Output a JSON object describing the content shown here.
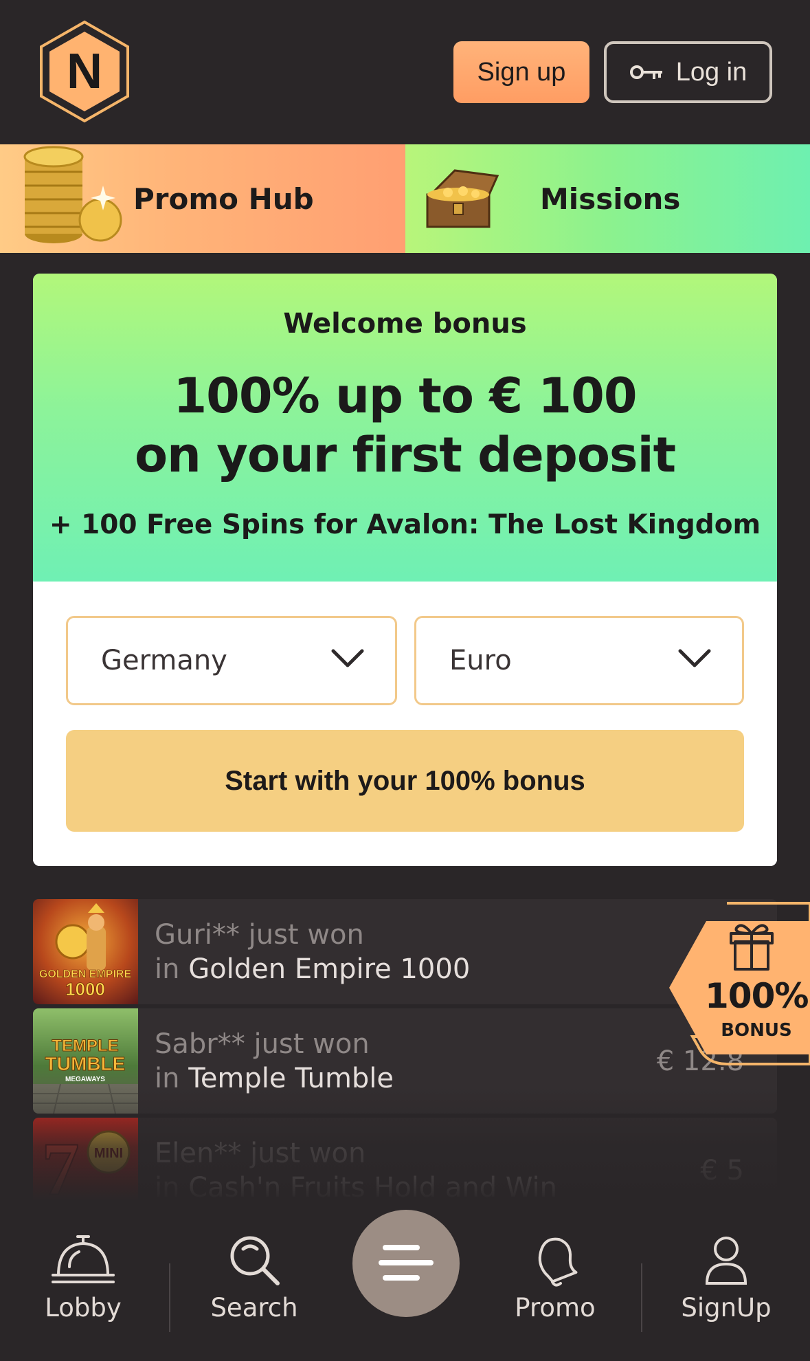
{
  "header": {
    "logo_letter": "N",
    "signup_label": "Sign up",
    "login_label": "Log in"
  },
  "promo_bar": {
    "promo_hub_label": "Promo Hub",
    "missions_label": "Missions"
  },
  "bonus": {
    "eyebrow": "Welcome bonus",
    "headline_line1": "100% up to € 100",
    "headline_line2": "on your first deposit",
    "subline": "+ 100 Free Spins for Avalon: The Lost Kingdom",
    "country_value": "Germany",
    "currency_value": "Euro",
    "cta_label": "Start with your 100% bonus"
  },
  "feed": {
    "rows": [
      {
        "player": "Guri** just won",
        "prefix": "in ",
        "game": "Golden Empire 1000",
        "amount": "€",
        "thumb_line1": "GOLDEN EMPIRE",
        "thumb_line2": "1000"
      },
      {
        "player": "Sabr** just won",
        "prefix": "in ",
        "game": "Temple Tumble",
        "amount": "€ 12.8",
        "thumb_line1": "TEMPLE",
        "thumb_line2": "TUMBLE",
        "thumb_line3": "MEGAWAYS"
      },
      {
        "player": "Elen** just won",
        "prefix": "in ",
        "game": "Cash'n Fruits Hold and Win",
        "amount": "€ 5",
        "thumb_line1": "MINI"
      }
    ]
  },
  "bonus_badge": {
    "percent": "100%",
    "label": "BONUS"
  },
  "bottom_nav": {
    "lobby": "Lobby",
    "search": "Search",
    "promo": "Promo",
    "signup": "SignUp"
  },
  "colors": {
    "background": "#2a2628",
    "accent_orange": "#ff9d63",
    "accent_green": "#6ef0b0",
    "cta_yellow": "#f5cf82"
  }
}
